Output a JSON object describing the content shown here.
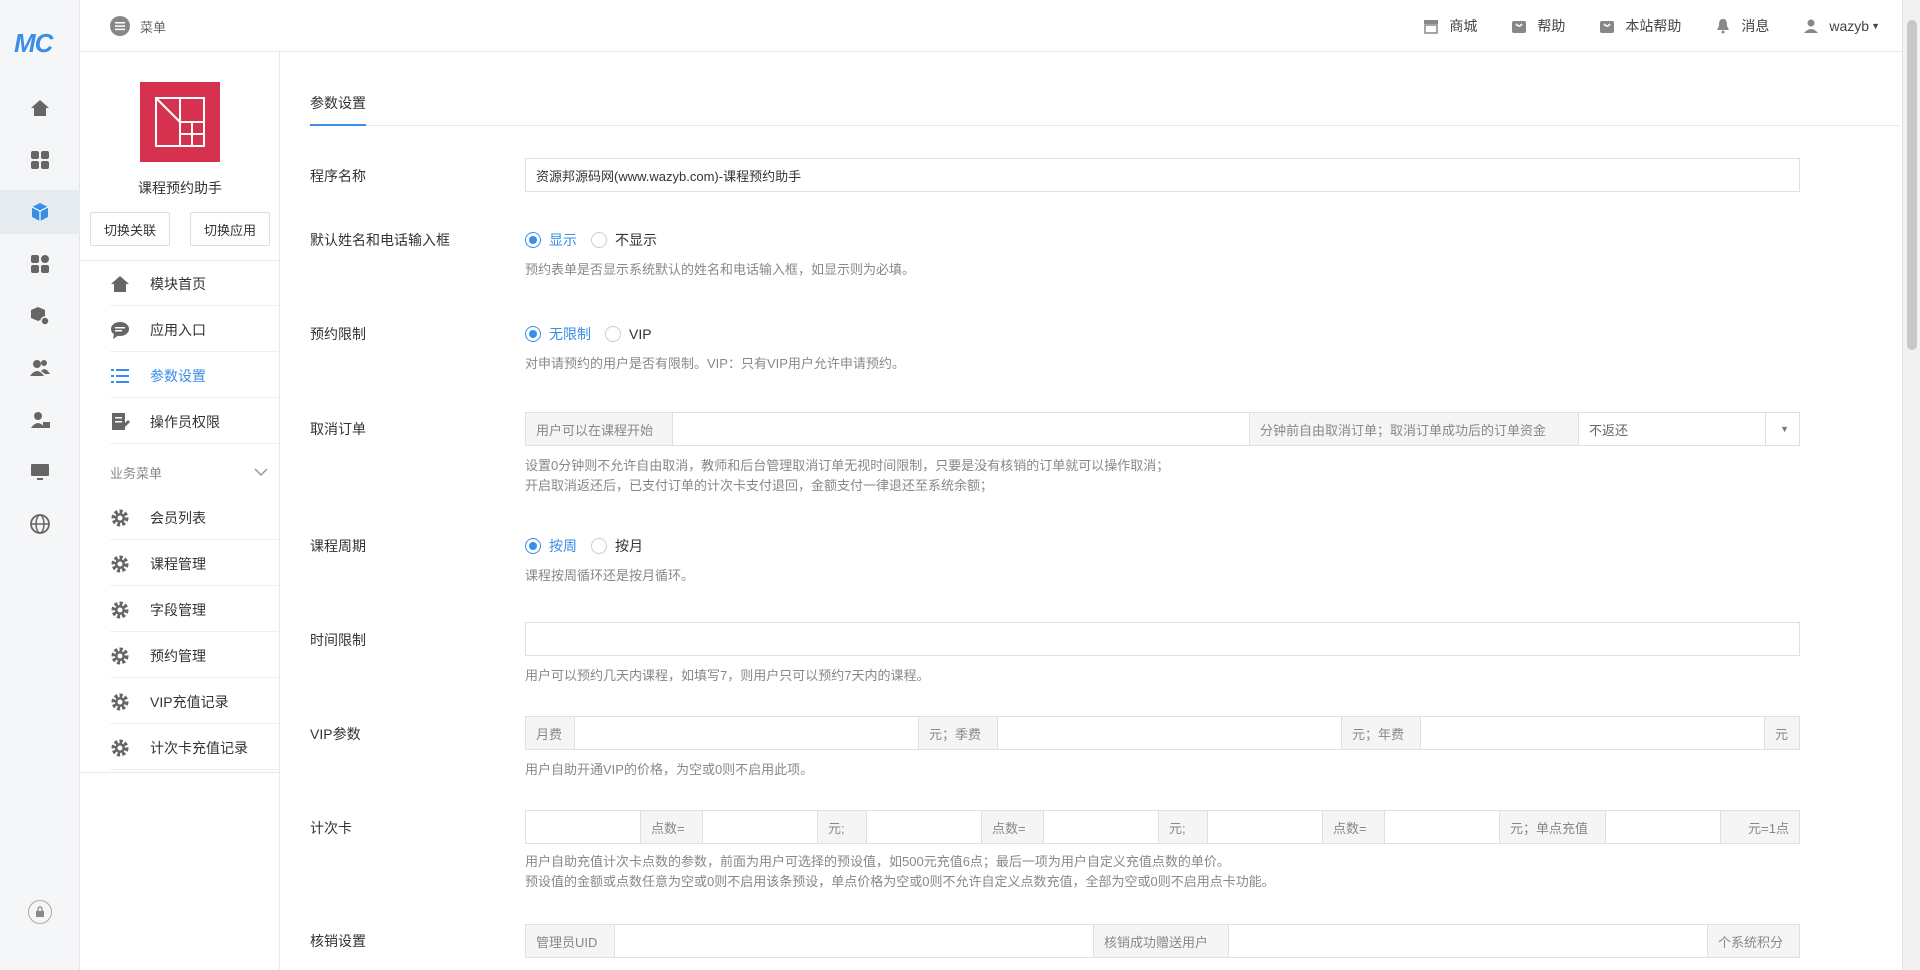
{
  "topbar": {
    "logo": "MC",
    "menu_label": "菜单",
    "nav": [
      {
        "label": "商城",
        "icon": "store-icon"
      },
      {
        "label": "帮助",
        "icon": "help-bag-icon"
      },
      {
        "label": "本站帮助",
        "icon": "site-help-icon"
      },
      {
        "label": "消息",
        "icon": "bell-icon"
      },
      {
        "label": "wazyb",
        "icon": "user-icon"
      }
    ]
  },
  "iconbar": {
    "items": [
      "home-icon",
      "grid-icon",
      "cube-icon",
      "apps-icon",
      "package-icon",
      "users-icon",
      "user-lock-icon",
      "monitor-icon",
      "globe-icon"
    ],
    "active_index": 2,
    "bottom": "lock-icon"
  },
  "sidebar": {
    "app_name": "课程预约助手",
    "switch_link": "切换关联",
    "switch_app": "切换应用",
    "items": [
      {
        "label": "模块首页",
        "icon": "home-icon"
      },
      {
        "label": "应用入口",
        "icon": "chat-icon"
      },
      {
        "label": "参数设置",
        "icon": "list-icon"
      },
      {
        "label": "操作员权限",
        "icon": "document-edit-icon"
      }
    ],
    "section_label": "业务菜单",
    "biz_items": [
      {
        "label": "会员列表"
      },
      {
        "label": "课程管理"
      },
      {
        "label": "字段管理"
      },
      {
        "label": "预约管理"
      },
      {
        "label": "VIP充值记录"
      },
      {
        "label": "计次卡充值记录"
      }
    ]
  },
  "tabs": {
    "active": "参数设置"
  },
  "form": {
    "name": {
      "label": "程序名称",
      "value": "资源邦源码网(www.wazyb.com)-课程预约助手"
    },
    "show_fields": {
      "label": "默认姓名和电话输入框",
      "opt1": "显示",
      "opt2": "不显示",
      "hint": "预约表单是否显示系统默认的姓名和电话输入框，如显示则为必填。"
    },
    "limit": {
      "label": "预约限制",
      "opt1": "无限制",
      "opt2": "VIP",
      "hint": "对申请预约的用户是否有限制。VIP：只有VIP用户允许申请预约。"
    },
    "cancel": {
      "label": "取消订单",
      "prefix": "用户可以在课程开始",
      "middle": "分钟前自由取消订单；取消订单成功后的订单资金",
      "select": "不返还",
      "hint1": "设置0分钟则不允许自由取消，教师和后台管理取消订单无视时间限制，只要是没有核销的订单就可以操作取消；",
      "hint2": "开启取消返还后，已支付订单的计次卡支付退回，金额支付一律退还至系统余额；"
    },
    "cycle": {
      "label": "课程周期",
      "opt1": "按周",
      "opt2": "按月",
      "hint": "课程按周循环还是按月循环。"
    },
    "time_limit": {
      "label": "时间限制",
      "hint": "用户可以预约几天内课程，如填写7，则用户只可以预约7天内的课程。"
    },
    "vip": {
      "label": "VIP参数",
      "a1": "月费",
      "a2": "元；季费",
      "a3": "元；年费",
      "a4": "元",
      "hint": "用户自助开通VIP的价格，为空或0则不启用此项。"
    },
    "card": {
      "label": "计次卡",
      "points": "点数=",
      "yuan": "元;",
      "single": "元；单点充值",
      "per": "元=1点",
      "hint1": "用户自助充值计次卡点数的参数，前面为用户可选择的预设值，如500元充值6点；最后一项为用户自定义充值点数的单价。",
      "hint2": "预设值的金额或点数任意为空或0则不启用该条预设，单点价格为空或0则不允许自定义点数充值，全部为空或0则不启用点卡功能。"
    },
    "verify": {
      "label": "核销设置",
      "admin": "管理员UID",
      "gift": "核销成功赠送用户",
      "unit": "个系统积分"
    }
  }
}
